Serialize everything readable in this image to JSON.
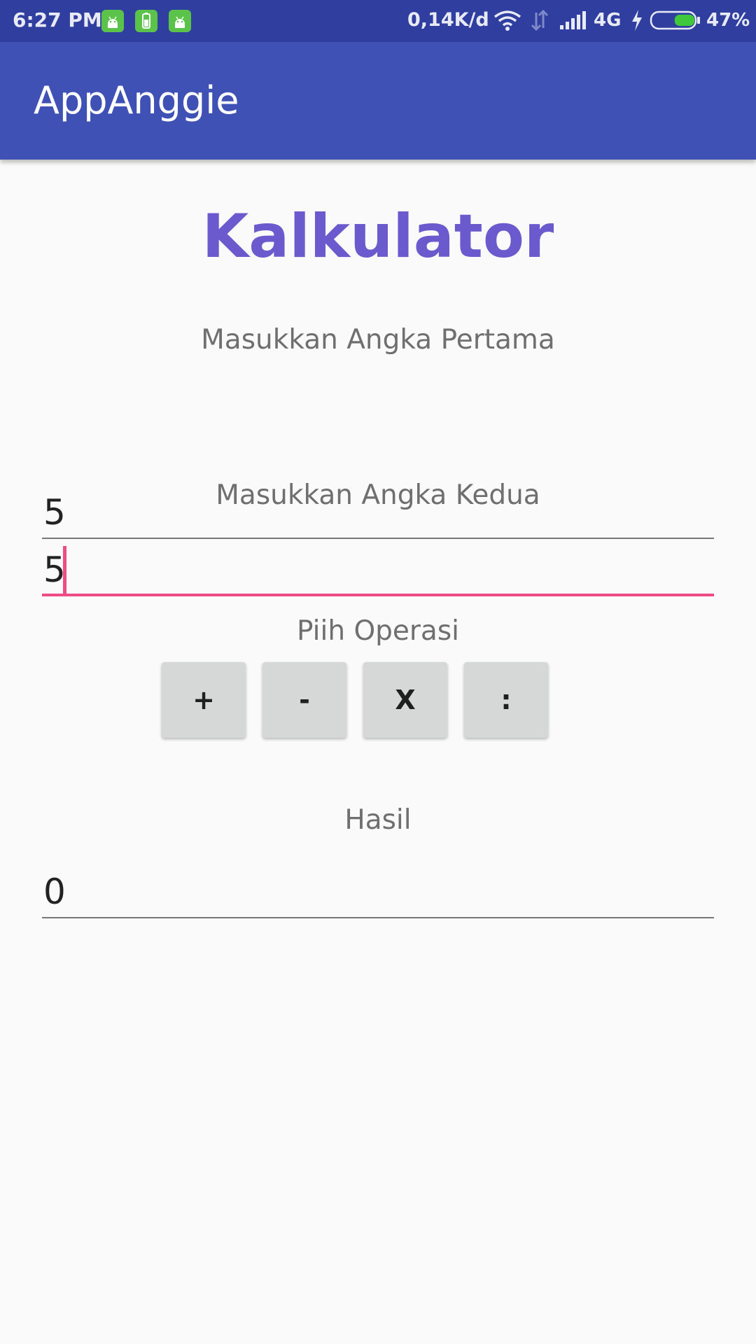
{
  "status_bar": {
    "time": "6:27 PM",
    "network_speed": "0,14K/d",
    "network_type": "4G",
    "battery_percent": "47%",
    "battery_level": 0.47,
    "notification_icons": [
      "android-icon",
      "battery-app-icon",
      "android-icon"
    ]
  },
  "app_bar": {
    "title": "AppAnggie",
    "color": "#3f51b5"
  },
  "main": {
    "heading": "Kalkulator",
    "heading_color": "#6a5acd",
    "first_number": {
      "label": "Masukkan Angka Pertama",
      "value": "5"
    },
    "second_number": {
      "label": "Masukkan Angka Kedua",
      "value": "5",
      "focused": true,
      "accent_color": "#ef4b85"
    },
    "operation": {
      "label": "Piih Operasi",
      "buttons": [
        "+",
        "-",
        "X",
        ":"
      ]
    },
    "result": {
      "label": "Hasil",
      "value": "0"
    }
  }
}
